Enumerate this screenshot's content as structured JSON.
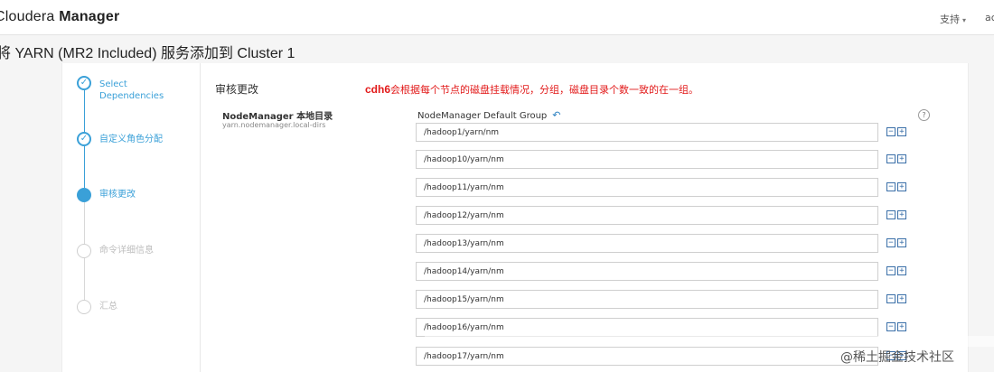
{
  "header": {
    "brand_thin": "Cloudera ",
    "brand_bold": "Manager",
    "support_label": "支持",
    "user_truncated": "ac"
  },
  "page": {
    "title": "将 YARN (MR2 Included) 服务添加到 Cluster 1"
  },
  "wizard": {
    "steps": [
      {
        "label": "Select Dependencies",
        "state": "done"
      },
      {
        "label": "自定义角色分配",
        "state": "done"
      },
      {
        "label": "审核更改",
        "state": "current"
      },
      {
        "label": "命令详细信息",
        "state": "todo"
      },
      {
        "label": "汇总",
        "state": "todo"
      }
    ]
  },
  "review": {
    "section_title": "审核更改",
    "annotation_bold": "cdh6",
    "annotation_text": "会根据每个节点的磁盘挂载情况，分组，磁盘目录个数一致的在一组。",
    "field_label": "NodeManager 本地目录",
    "field_key": "yarn.nodemanager.local-dirs",
    "group_label": "NodeManager Default Group",
    "dirs": [
      "/hadoop1/yarn/nm",
      "/hadoop10/yarn/nm",
      "/hadoop11/yarn/nm",
      "/hadoop12/yarn/nm",
      "/hadoop13/yarn/nm",
      "/hadoop14/yarn/nm",
      "/hadoop15/yarn/nm",
      "/hadoop16/yarn/nm",
      "/hadoop17/yarn/nm"
    ]
  },
  "watermark": "@稀土掘金技术社区",
  "colors": {
    "accent": "#3aa0d8",
    "annotation": "#e21a1a",
    "link": "#2a7fc0"
  },
  "icons": [
    "check-icon",
    "undo-icon",
    "help-icon",
    "minus-icon",
    "plus-icon",
    "caret-down-icon"
  ]
}
